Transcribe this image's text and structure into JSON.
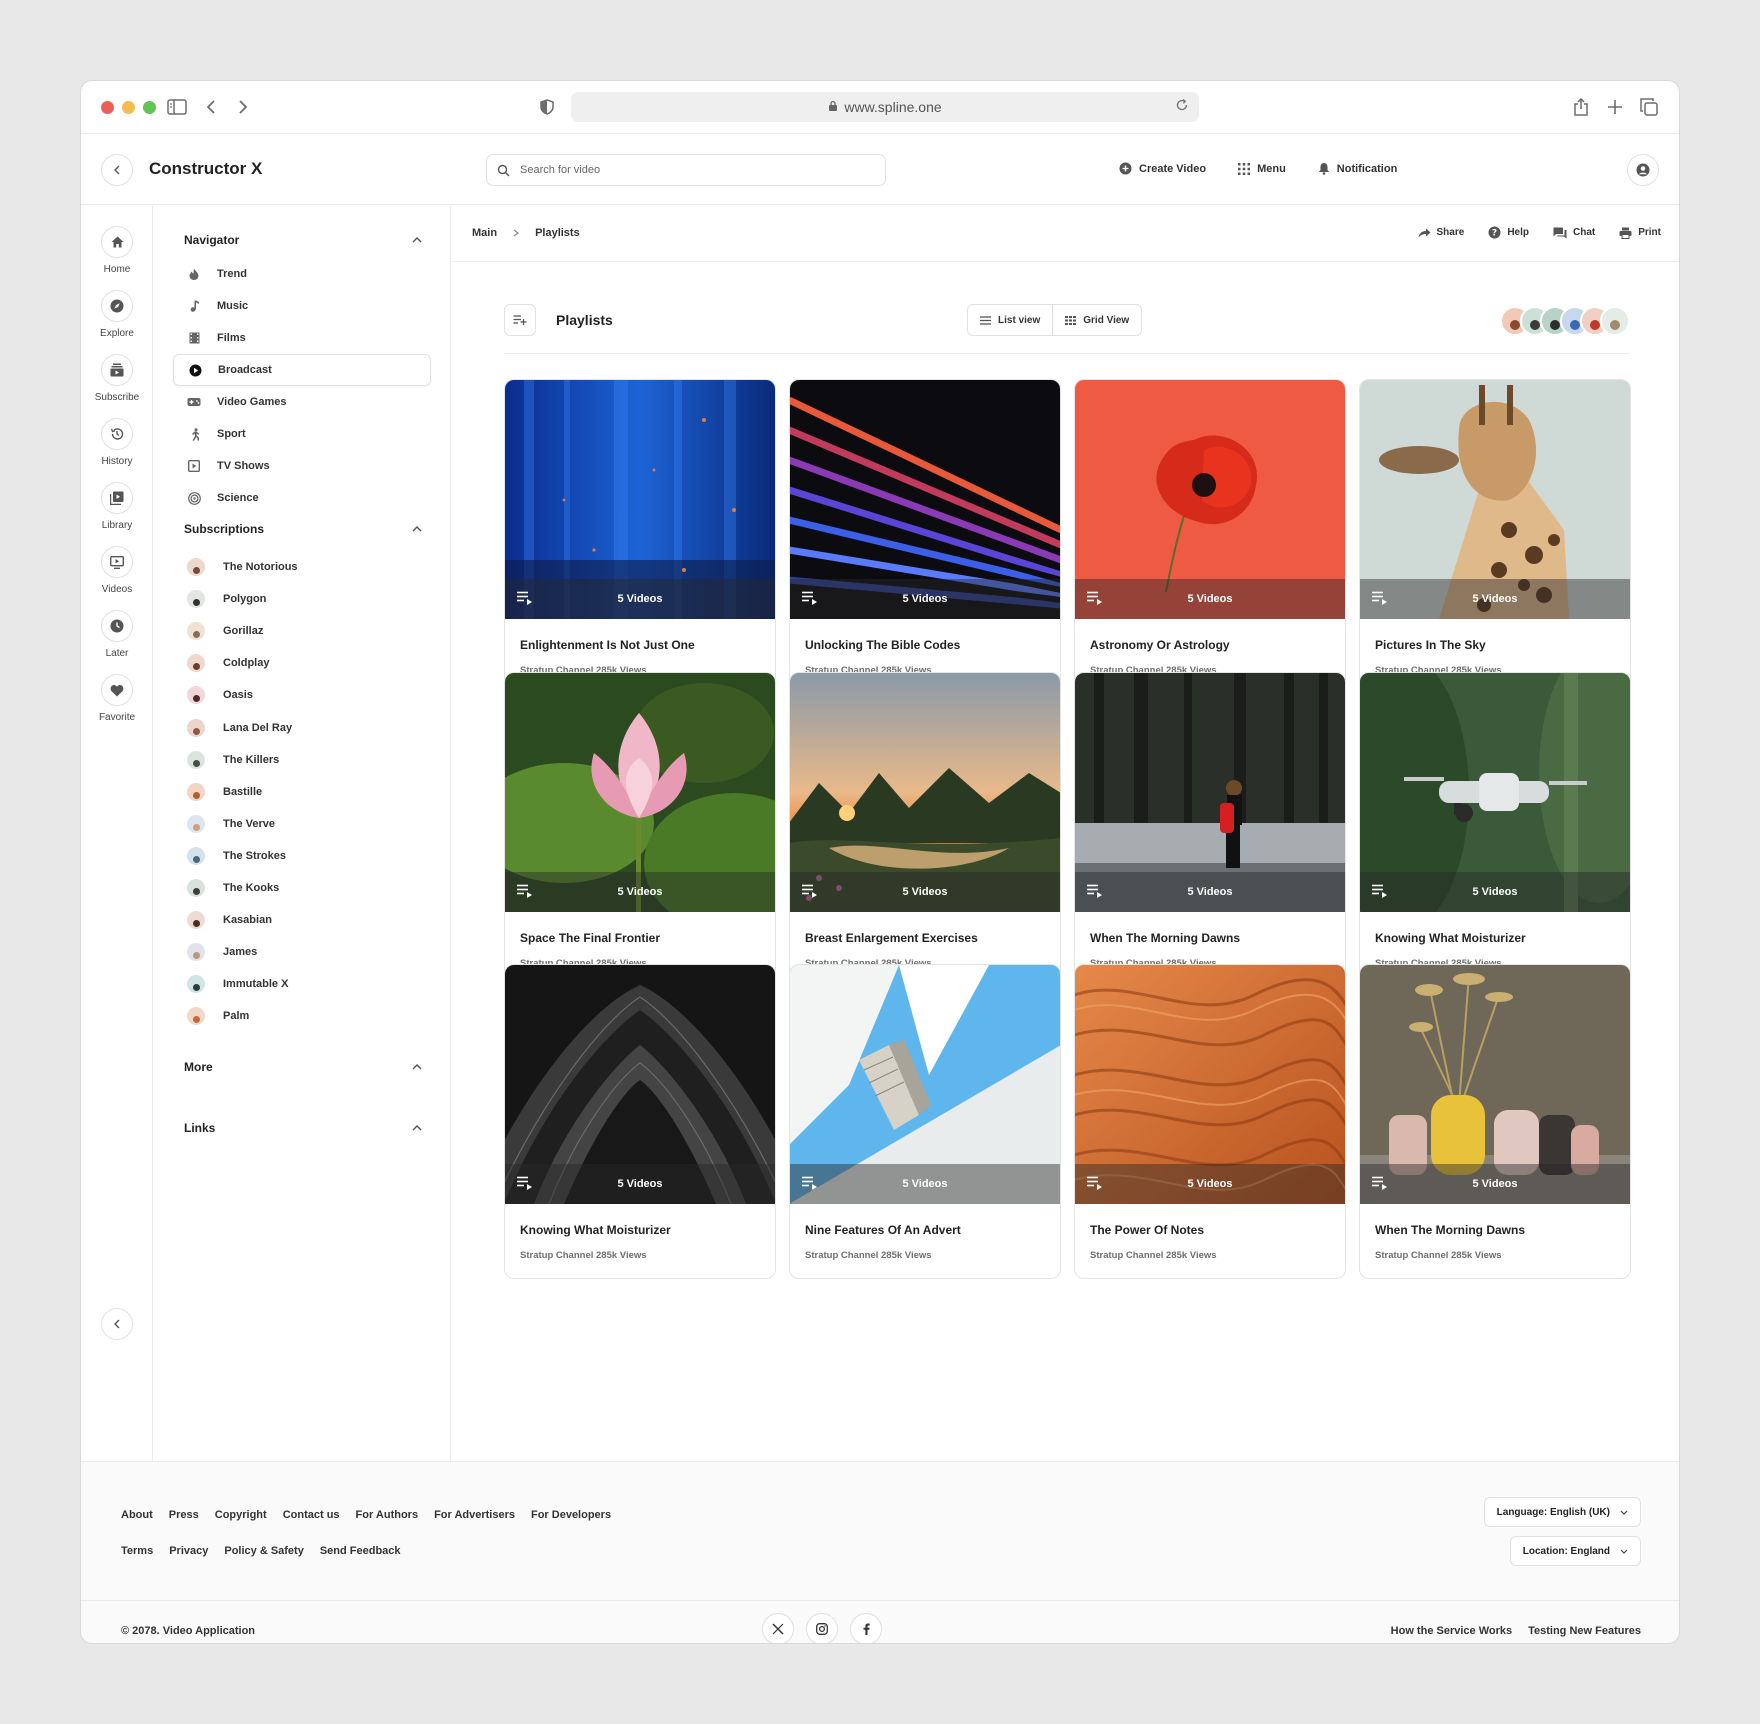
{
  "browser": {
    "url": "www.spline.one"
  },
  "app": {
    "title": "Constructor X",
    "search_placeholder": "Search for video",
    "actions": [
      {
        "label": "Create Video",
        "icon": "plus-circle-icon"
      },
      {
        "label": "Menu",
        "icon": "grid-icon"
      },
      {
        "label": "Notification",
        "icon": "bell-icon"
      }
    ]
  },
  "rail": [
    {
      "label": "Home",
      "icon": "home-icon"
    },
    {
      "label": "Explore",
      "icon": "compass-icon"
    },
    {
      "label": "Subscribe",
      "icon": "subscribe-icon"
    },
    {
      "label": "History",
      "icon": "history-icon"
    },
    {
      "label": "Library",
      "icon": "library-icon"
    },
    {
      "label": "Videos",
      "icon": "video-icon"
    },
    {
      "label": "Later",
      "icon": "clock-icon"
    },
    {
      "label": "Favorite",
      "icon": "heart-icon"
    }
  ],
  "navigator": {
    "title": "Navigator",
    "items": [
      {
        "label": "Trend",
        "icon": "fire-icon"
      },
      {
        "label": "Music",
        "icon": "music-icon"
      },
      {
        "label": "Films",
        "icon": "film-icon"
      },
      {
        "label": "Broadcast",
        "icon": "play-circle-icon",
        "active": true
      },
      {
        "label": "Video Games",
        "icon": "gamepad-icon"
      },
      {
        "label": "Sport",
        "icon": "run-icon"
      },
      {
        "label": "TV Shows",
        "icon": "tv-icon"
      },
      {
        "label": "Science",
        "icon": "radar-icon"
      }
    ]
  },
  "subscriptions": {
    "title": "Subscriptions",
    "items": [
      "The Notorious",
      "Polygon",
      "Gorillaz",
      "Coldplay",
      "Oasis",
      "Lana Del Ray",
      "The Killers",
      "Bastille",
      "The Verve",
      "The Strokes",
      "The Kooks",
      "Kasabian",
      "James",
      "Immutable X",
      "Palm"
    ]
  },
  "more": {
    "title": "More"
  },
  "links": {
    "title": "Links"
  },
  "breadcrumb": {
    "main": "Main",
    "current": "Playlists"
  },
  "utilities": [
    {
      "label": "Share",
      "icon": "share-icon"
    },
    {
      "label": "Help",
      "icon": "help-icon"
    },
    {
      "label": "Chat",
      "icon": "chat-icon"
    },
    {
      "label": "Print",
      "icon": "print-icon"
    }
  ],
  "playlists": {
    "title": "Playlists",
    "list_view": "List view",
    "grid_view": "Grid View",
    "cards": [
      {
        "title": "Enlightenment Is Not Just One",
        "meta": "Stratup Channel 285k Views",
        "count": "5 Videos"
      },
      {
        "title": "Unlocking The Bible Codes",
        "meta": "Stratup Channel 285k Views",
        "count": "5 Videos"
      },
      {
        "title": "Astronomy Or Astrology",
        "meta": "Stratup Channel 285k Views",
        "count": "5 Videos"
      },
      {
        "title": "Pictures In The Sky",
        "meta": "Stratup Channel 285k Views",
        "count": "5 Videos"
      },
      {
        "title": "Space The Final Frontier",
        "meta": "Stratup Channel 285k Views",
        "count": "5 Videos"
      },
      {
        "title": "Breast Enlargement Exercises",
        "meta": "Stratup Channel 285k Views",
        "count": "5 Videos"
      },
      {
        "title": "When The Morning Dawns",
        "meta": "Stratup Channel 285k Views",
        "count": "5 Videos"
      },
      {
        "title": "Knowing What Moisturizer",
        "meta": "Stratup Channel 285k Views",
        "count": "5 Videos"
      },
      {
        "title": "Knowing What Moisturizer",
        "meta": "Stratup Channel 285k Views",
        "count": "5 Videos"
      },
      {
        "title": "Nine Features Of An Advert",
        "meta": "Stratup Channel 285k Views",
        "count": "5 Videos"
      },
      {
        "title": "The Power Of Notes",
        "meta": "Stratup Channel 285k Views",
        "count": "5 Videos"
      },
      {
        "title": "When The Morning Dawns",
        "meta": "Stratup Channel 285k Views",
        "count": "5 Videos"
      }
    ]
  },
  "footer": {
    "links_row1": [
      "About",
      "Press",
      "Copyright",
      "Contact us",
      "For Authors",
      "For Advertisers",
      "For Developers"
    ],
    "links_row2": [
      "Terms",
      "Privacy",
      "Policy & Safety",
      "Send Feedback"
    ],
    "language": "Language: English (UK)",
    "location": "Location: England",
    "copyright": "© 2078. Video Application",
    "socials": [
      "x-icon",
      "instagram-icon",
      "facebook-icon"
    ],
    "right_links": [
      "How the Service Works",
      "Testing New Features"
    ]
  },
  "colors": {
    "close": "#ec5f57",
    "minimize": "#f4bd4f",
    "maximize": "#61c454",
    "text": "#1f1f1f",
    "muted": "#6f6f6f",
    "border": "#e1e1e1"
  }
}
